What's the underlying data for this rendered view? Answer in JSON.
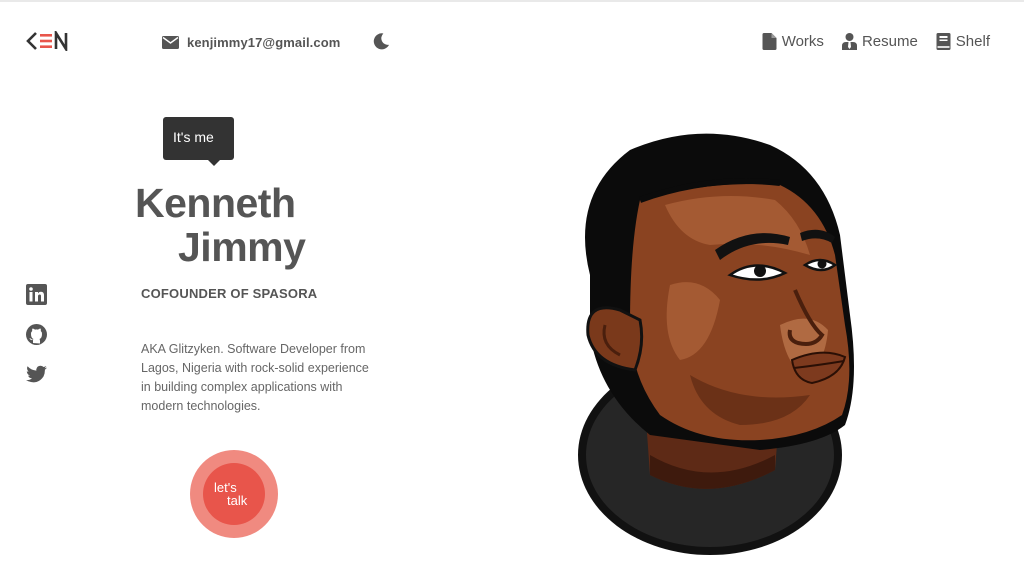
{
  "logo": {
    "text": "KEN"
  },
  "header": {
    "email": "kenjimmy17@gmail.com",
    "theme_toggle_icon": "moon-icon",
    "nav": [
      {
        "label": "Works",
        "icon": "document-icon"
      },
      {
        "label": "Resume",
        "icon": "user-tie-icon"
      },
      {
        "label": "Shelf",
        "icon": "book-icon"
      }
    ]
  },
  "hero": {
    "tooltip": "It's me",
    "first_name": "Kenneth",
    "last_name": "Jimmy",
    "role": "COFOUNDER OF SPASORA",
    "bio": "AKA Glitzyken. Software Developer from Lagos, Nigeria with rock-solid experience in building complex applications with modern technologies.",
    "cta_line1": "let's",
    "cta_line2": "talk"
  },
  "social": [
    "linkedin-icon",
    "github-icon",
    "twitter-icon"
  ],
  "colors": {
    "accent": "#e8554b",
    "accent_light": "#f08a80",
    "text": "#555555",
    "tooltip_bg": "#333333"
  }
}
